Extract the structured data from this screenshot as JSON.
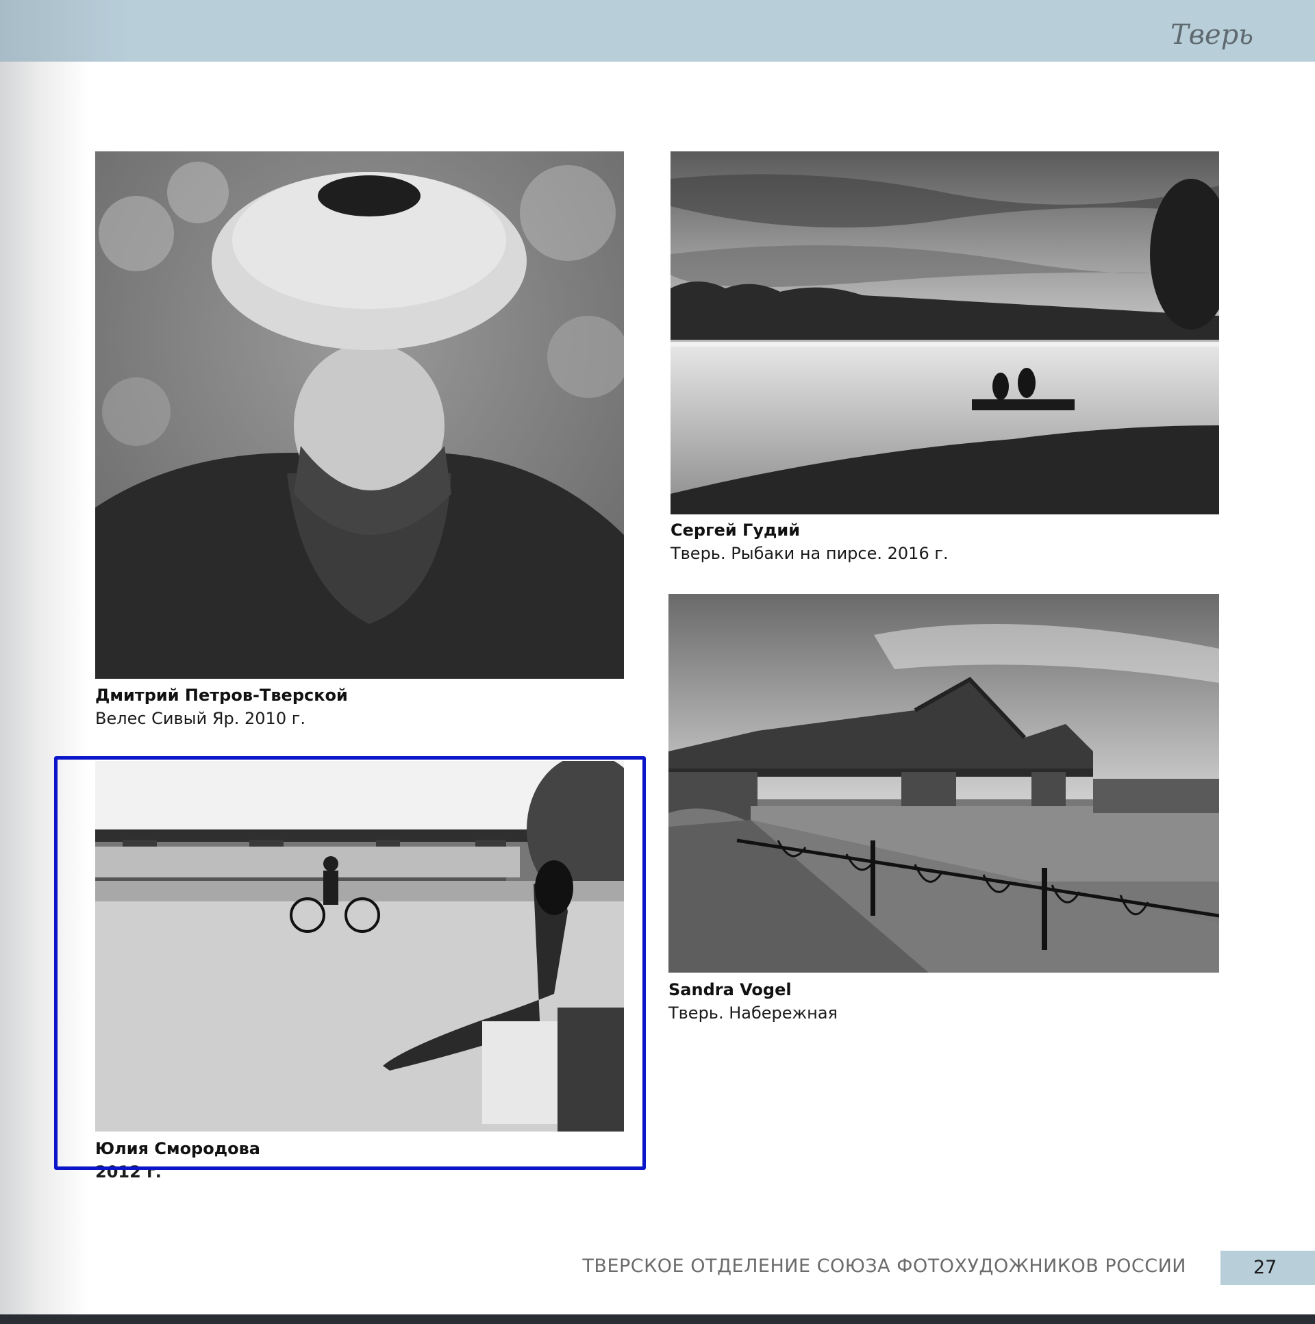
{
  "header": {
    "title": "Тверь"
  },
  "photos": [
    {
      "author": "Дмитрий Петров-Тверской",
      "title": "Велес Сивый Яр. 2010 г."
    },
    {
      "author": "Сергей Гудий",
      "title": "Тверь. Рыбаки на пирсе. 2016 г."
    },
    {
      "author": "Юлия Смородова",
      "title": "2012 г."
    },
    {
      "author": "Sandra Vogel",
      "title": "Тверь. Набережная"
    }
  ],
  "footer": {
    "organization": "ТВЕРСКОЕ ОТДЕЛЕНИЕ СОЮЗА ФОТОХУДОЖНИКОВ РОССИИ",
    "page_number": "27"
  }
}
